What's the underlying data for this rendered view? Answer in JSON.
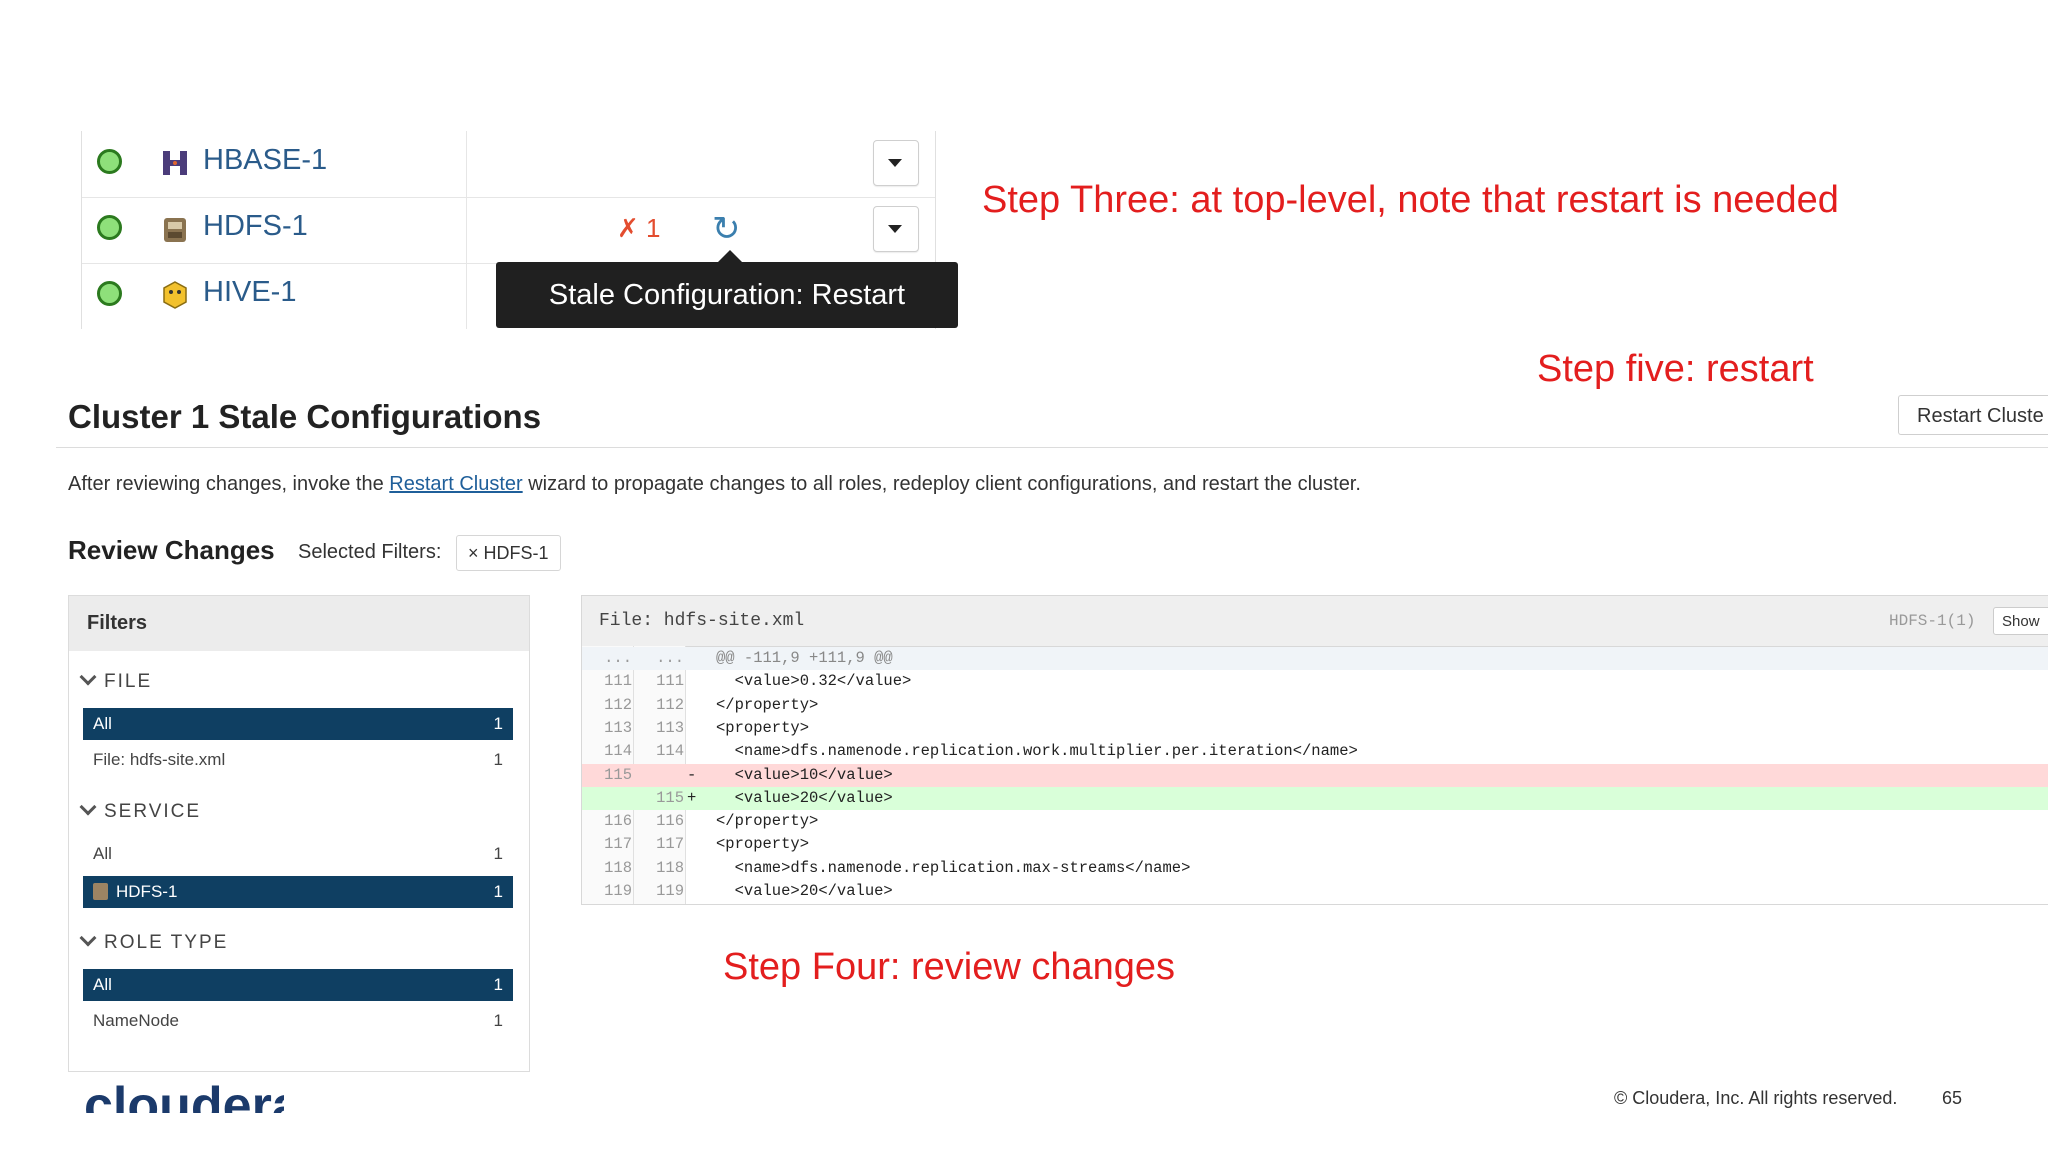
{
  "services": [
    {
      "name": "HBASE-1",
      "icon": "hbase-icon",
      "status": "good"
    },
    {
      "name": "HDFS-1",
      "icon": "hdfs-icon",
      "status": "good",
      "stale_count": "1"
    },
    {
      "name": "HIVE-1",
      "icon": "hive-icon",
      "status": "good"
    }
  ],
  "tooltip": "Stale Configuration: Restart",
  "annotations": {
    "step3": "Step Three: at top-level, note that restart is needed",
    "step5": "Step five: restart",
    "step4": "Step Four: review changes"
  },
  "restart_button": "Restart Cluste",
  "page_title": "Cluster 1 Stale Configurations",
  "description": {
    "before": "After reviewing changes, invoke the ",
    "link": "Restart Cluster",
    "after": " wizard to propagate changes to all roles, redeploy client configurations, and restart the cluster."
  },
  "review": {
    "title": "Review Changes",
    "selected_label": "Selected Filters:",
    "chip": "× HDFS-1"
  },
  "filters": {
    "title": "Filters",
    "groups": [
      {
        "title": "FILE",
        "items": [
          {
            "label": "All",
            "count": "1",
            "active": true
          },
          {
            "label": "File: hdfs-site.xml",
            "count": "1",
            "active": false
          }
        ]
      },
      {
        "title": "SERVICE",
        "items": [
          {
            "label": "All",
            "count": "1",
            "active": false
          },
          {
            "label": "HDFS-1",
            "count": "1",
            "active": true
          }
        ]
      },
      {
        "title": "ROLE TYPE",
        "items": [
          {
            "label": "All",
            "count": "1",
            "active": true
          },
          {
            "label": "NameNode",
            "count": "1",
            "active": false
          }
        ]
      }
    ]
  },
  "diff": {
    "file": "File: hdfs-site.xml",
    "service": "HDFS-1(1)",
    "show": "Show",
    "lines": [
      {
        "type": "hunk",
        "l1": "...",
        "l2": "...",
        "sign": "",
        "code": "@@ -111,9 +111,9 @@"
      },
      {
        "type": "ctx",
        "l1": "111",
        "l2": "111",
        "sign": "",
        "code": "  <value>0.32</value>"
      },
      {
        "type": "ctx",
        "l1": "112",
        "l2": "112",
        "sign": "",
        "code": "</property>"
      },
      {
        "type": "ctx",
        "l1": "113",
        "l2": "113",
        "sign": "",
        "code": "<property>"
      },
      {
        "type": "ctx",
        "l1": "114",
        "l2": "114",
        "sign": "",
        "code": "  <name>dfs.namenode.replication.work.multiplier.per.iteration</name>"
      },
      {
        "type": "del",
        "l1": "115",
        "l2": "",
        "sign": "-",
        "code": "  <value>10</value>"
      },
      {
        "type": "add",
        "l1": "",
        "l2": "115",
        "sign": "+",
        "code": "  <value>20</value>"
      },
      {
        "type": "ctx",
        "l1": "116",
        "l2": "116",
        "sign": "",
        "code": "</property>"
      },
      {
        "type": "ctx",
        "l1": "117",
        "l2": "117",
        "sign": "",
        "code": "<property>"
      },
      {
        "type": "ctx",
        "l1": "118",
        "l2": "118",
        "sign": "",
        "code": "  <name>dfs.namenode.replication.max-streams</name>"
      },
      {
        "type": "ctx",
        "l1": "119",
        "l2": "119",
        "sign": "",
        "code": "  <value>20</value>"
      }
    ]
  },
  "footer": {
    "logo": "cloudera",
    "copyright": "© Cloudera, Inc. All rights reserved.",
    "page": "65"
  },
  "colors": {
    "annotation": "#e31e1e",
    "active_filter": "#0f3f62",
    "link": "#1f5f9a"
  }
}
